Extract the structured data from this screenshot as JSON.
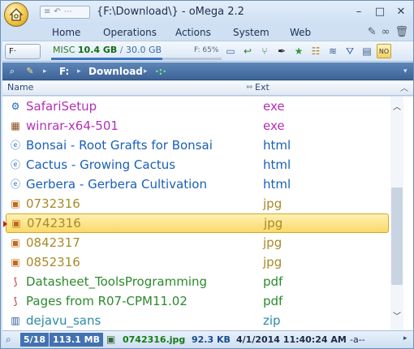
{
  "window": {
    "title": "{F:\\Download\\} - oMega 2.2",
    "quick_access": [
      "≡",
      "↶",
      "⋯"
    ],
    "controls": {
      "minimize": "–",
      "maximize": "□",
      "close": "✕"
    }
  },
  "menu": {
    "items": [
      "Home",
      "Operations",
      "Actions",
      "System",
      "Web"
    ]
  },
  "toolbar": {
    "drive_button": "F·",
    "drive_label": "MISC",
    "used": "10.4 GB",
    "separator": "/",
    "total": "30.0 GB",
    "free_percent_label": "F: 65%",
    "free_fraction": 0.65,
    "icons": [
      "screen-icon",
      "back-icon",
      "branch-icon",
      "pen-icon",
      "star-icon",
      "fav-icon",
      "list-icon",
      "filter-icon",
      "view-icon",
      "hex-icon"
    ]
  },
  "pathbar": {
    "segments": [
      "F:",
      "Download"
    ],
    "tail": "·:·"
  },
  "columns": {
    "name": "Name",
    "ext": "Ext"
  },
  "files": [
    {
      "name": "SafariSetup",
      "ext": "exe",
      "icon": "installer-icon",
      "color": "#b42fb4"
    },
    {
      "name": "winrar-x64-501",
      "ext": "exe",
      "icon": "archive-installer-icon",
      "color": "#b42fb4"
    },
    {
      "name": "Bonsai - Root Grafts for Bonsai",
      "ext": "html",
      "icon": "web-page-icon",
      "color": "#1a5fb8"
    },
    {
      "name": "Cactus - Growing Cactus",
      "ext": "html",
      "icon": "web-page-icon",
      "color": "#1a5fb8"
    },
    {
      "name": "Gerbera - Gerbera Cultivation",
      "ext": "html",
      "icon": "web-page-icon",
      "color": "#1a5fb8"
    },
    {
      "name": "0732316",
      "ext": "jpg",
      "icon": "image-icon",
      "color": "#a88a28"
    },
    {
      "name": "0742316",
      "ext": "jpg",
      "icon": "image-icon",
      "color": "#a88a28",
      "selected": true
    },
    {
      "name": "0842317",
      "ext": "jpg",
      "icon": "image-icon",
      "color": "#a88a28"
    },
    {
      "name": "0852316",
      "ext": "jpg",
      "icon": "image-icon",
      "color": "#a88a28"
    },
    {
      "name": "Datasheet_ToolsProgramming",
      "ext": "pdf",
      "icon": "pdf-icon",
      "color": "#2c8a2c"
    },
    {
      "name": "Pages from R07-CPM11.02",
      "ext": "pdf",
      "icon": "pdf-icon",
      "color": "#2c8a2c"
    },
    {
      "name": "dejavu_sans",
      "ext": "zip",
      "icon": "zip-icon",
      "color": "#2a8aa8"
    }
  ],
  "status": {
    "count": "5/18",
    "size": "113.1 MB",
    "file_name": "0742316.jpg",
    "file_size": "92.3 KB",
    "date": "4/1/2014 11:40:24 AM",
    "attributes": "-a--"
  }
}
